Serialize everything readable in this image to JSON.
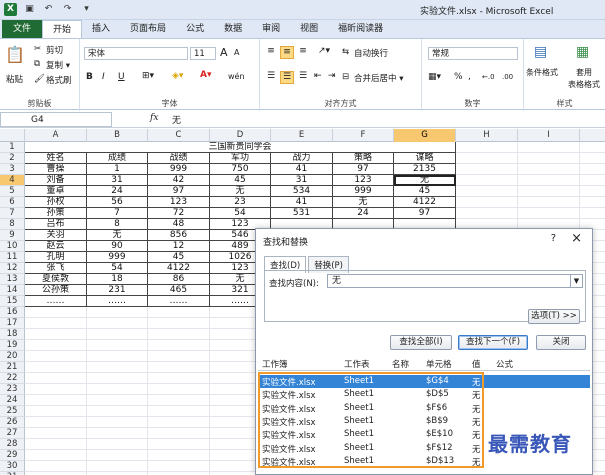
{
  "window": {
    "title": "实验文件.xlsx - Microsoft Excel"
  },
  "ribbon_tabs": [
    "文件",
    "开始",
    "插入",
    "页面布局",
    "公式",
    "数据",
    "审阅",
    "视图",
    "福昕阅读器"
  ],
  "ribbon": {
    "clipboard": {
      "paste": "粘贴",
      "cut": "剪切",
      "copy": "复制 ▾",
      "painter": "格式刷",
      "group": "剪贴板"
    },
    "font": {
      "name": "宋体",
      "size": "11",
      "bold": "B",
      "italic": "I",
      "underline": "U",
      "grow": "A",
      "shrink": "A",
      "phonetic": "wén",
      "group": "字体"
    },
    "alignment": {
      "wrap": "自动换行",
      "merge": "合并后居中 ▾",
      "group": "对齐方式"
    },
    "number": {
      "format": "常规",
      "percent": "%",
      "comma": ",",
      "inc": "←.0",
      "dec": ".00",
      "group": "数字"
    },
    "styles": {
      "cond": "条件格式",
      "table": "套用",
      "table2": "表格格式",
      "group": "样式"
    }
  },
  "formula_bar": {
    "name_box": "G4",
    "fx": "fx",
    "value": "无"
  },
  "columns": [
    "A",
    "B",
    "C",
    "D",
    "E",
    "F",
    "G",
    "H",
    "I",
    "J"
  ],
  "sheet": {
    "title": "三国新贵同学会",
    "headers": [
      "姓名",
      "成绩",
      "战绩",
      "军功",
      "战力",
      "策略",
      "谋略"
    ],
    "rows": [
      [
        "曹操",
        "1",
        "999",
        "750",
        "41",
        "97",
        "2135"
      ],
      [
        "刘备",
        "31",
        "42",
        "45",
        "31",
        "123",
        "无"
      ],
      [
        "董卓",
        "24",
        "97",
        "无",
        "534",
        "999",
        "45"
      ],
      [
        "孙权",
        "56",
        "123",
        "23",
        "41",
        "无",
        "4122"
      ],
      [
        "孙策",
        "7",
        "72",
        "54",
        "531",
        "24",
        "97"
      ],
      [
        "吕布",
        "8",
        "48",
        "123",
        "",
        "",
        ""
      ],
      [
        "关羽",
        "无",
        "856",
        "546",
        "",
        "",
        ""
      ],
      [
        "赵云",
        "90",
        "12",
        "489",
        "",
        "",
        ""
      ],
      [
        "孔明",
        "999",
        "45",
        "1026",
        "",
        "",
        ""
      ],
      [
        "张飞",
        "54",
        "4122",
        "123",
        "",
        "",
        ""
      ],
      [
        "夏侯敦",
        "18",
        "86",
        "无",
        "",
        "",
        ""
      ],
      [
        "公孙策",
        "231",
        "465",
        "321",
        "",
        "",
        ""
      ],
      [
        "……",
        "……",
        "……",
        "……",
        "",
        "",
        ""
      ]
    ],
    "row_numbers": [
      "1",
      "2",
      "3",
      "4",
      "5",
      "6",
      "7",
      "8",
      "9",
      "10",
      "11",
      "12",
      "13",
      "14",
      "15",
      "16",
      "17",
      "18",
      "19",
      "20",
      "21",
      "22",
      "23",
      "24",
      "25",
      "26",
      "27",
      "28",
      "29",
      "30",
      "31"
    ]
  },
  "dialog": {
    "title": "查找和替换",
    "help": "?",
    "close": "×",
    "tabs": [
      "查找(D)",
      "替换(P)"
    ],
    "find_label": "查找内容(N):",
    "find_value": "无",
    "options_button": "选项(T) >>",
    "find_all": "查找全部(I)",
    "find_next": "查找下一个(F)",
    "close_button": "关闭",
    "result_headers": [
      "工作簿",
      "工作表",
      "名称",
      "单元格",
      "值",
      "公式"
    ],
    "results": [
      [
        "实验文件.xlsx",
        "Sheet1",
        "",
        "$G$4",
        "无"
      ],
      [
        "实验文件.xlsx",
        "Sheet1",
        "",
        "$D$5",
        "无"
      ],
      [
        "实验文件.xlsx",
        "Sheet1",
        "",
        "$F$6",
        "无"
      ],
      [
        "实验文件.xlsx",
        "Sheet1",
        "",
        "$B$9",
        "无"
      ],
      [
        "实验文件.xlsx",
        "Sheet1",
        "",
        "$E$10",
        "无"
      ],
      [
        "实验文件.xlsx",
        "Sheet1",
        "",
        "$F$12",
        "无"
      ],
      [
        "实验文件.xlsx",
        "Sheet1",
        "",
        "$D$13",
        "无"
      ]
    ]
  },
  "watermark": "最需教育",
  "colors": {
    "accent": "#1f6b33",
    "selection": "#3383d6",
    "highlight_frame": "#f09a2a",
    "watermark": "#3857b8"
  }
}
